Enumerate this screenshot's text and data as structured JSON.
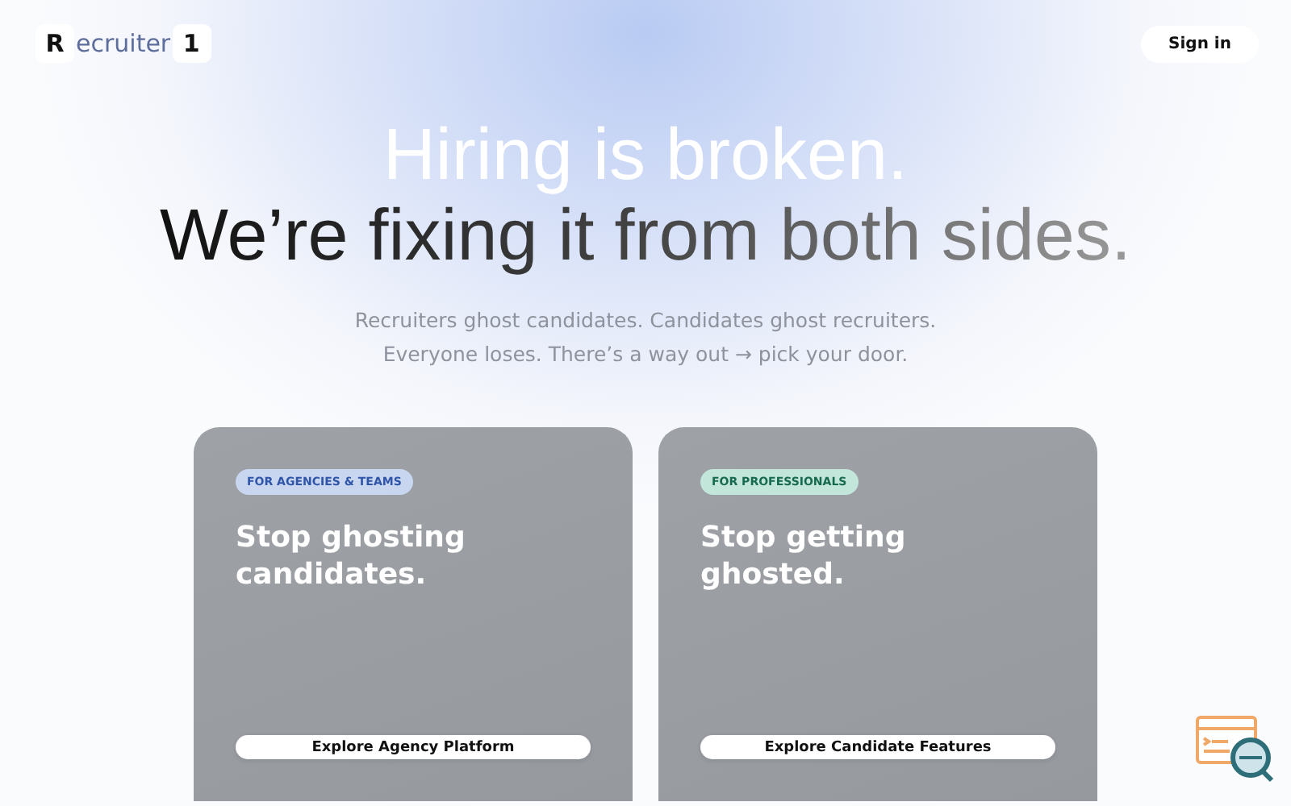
{
  "header": {
    "logo": {
      "first": "R",
      "middle": "ecruiter",
      "last": "1"
    },
    "sign_in": "Sign in"
  },
  "hero": {
    "title": "Hiring is broken.",
    "subtitle": "We’re fixing it from both sides.",
    "lines": [
      "Recruiters ghost candidates. Candidates ghost recruiters.",
      "Everyone loses. There’s a way out → pick your door."
    ]
  },
  "cards": [
    {
      "kind": "agency",
      "badge": "FOR AGENCIES & TEAMS",
      "title": "Stop ghosting candidates.",
      "button": "Explore Agency Platform"
    },
    {
      "kind": "professional",
      "badge": "FOR PROFESSIONALS",
      "title": "Stop getting ghosted.",
      "button": "Explore Candidate Features"
    }
  ]
}
